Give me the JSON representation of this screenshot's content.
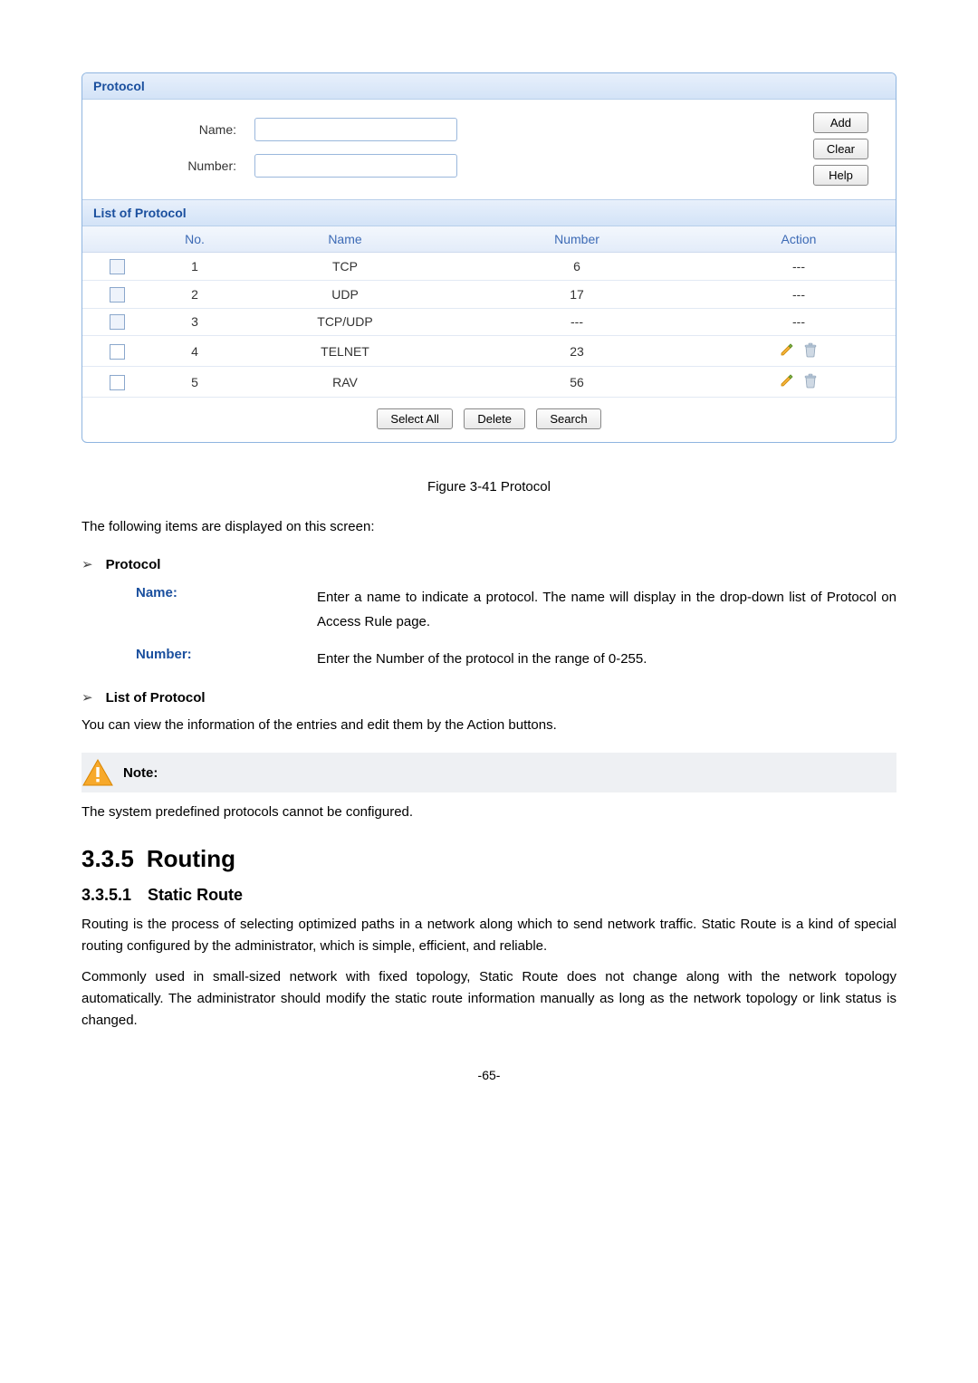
{
  "panel": {
    "title": "Protocol",
    "form": {
      "name_label": "Name:",
      "name_value": "",
      "number_label": "Number:",
      "number_value": ""
    },
    "buttons": {
      "add": "Add",
      "clear": "Clear",
      "help": "Help"
    },
    "list_title": "List of Protocol",
    "columns": {
      "chk": "",
      "no": "No.",
      "name": "Name",
      "number": "Number",
      "action": "Action"
    },
    "rows": [
      {
        "chk_disabled": true,
        "no": "1",
        "name": "TCP",
        "number": "6",
        "action": "text",
        "action_text": "---"
      },
      {
        "chk_disabled": true,
        "no": "2",
        "name": "UDP",
        "number": "17",
        "action": "text",
        "action_text": "---"
      },
      {
        "chk_disabled": true,
        "no": "3",
        "name": "TCP/UDP",
        "number": "---",
        "action": "text",
        "action_text": "---"
      },
      {
        "chk_disabled": false,
        "no": "4",
        "name": "TELNET",
        "number": "23",
        "action": "icons"
      },
      {
        "chk_disabled": false,
        "no": "5",
        "name": "RAV",
        "number": "56",
        "action": "icons"
      }
    ],
    "bottom_buttons": {
      "select_all": "Select All",
      "delete": "Delete",
      "search": "Search"
    }
  },
  "caption": "Figure 3-41 Protocol",
  "intro": "The following items are displayed on this screen:",
  "sections": {
    "protocol_bullet": "Protocol",
    "name_term": "Name:",
    "name_desc": "Enter a name to indicate a protocol. The name will display in the drop-down list of Protocol on Access Rule page.",
    "number_term": "Number:",
    "number_desc": "Enter the Number of the protocol in the range of 0-255.",
    "list_bullet": "List of Protocol",
    "list_desc": "You can view the information of the entries and edit them by the Action buttons."
  },
  "note": {
    "label": "Note:",
    "text": "The system predefined protocols cannot be configured."
  },
  "routing": {
    "section_num": "3.3.5",
    "section_title": "Routing",
    "sub_num": "3.3.5.1",
    "sub_title": "Static Route",
    "p1": "Routing is the process of selecting optimized paths in a network along which to send network traffic. Static Route is a kind of special routing configured by the administrator, which is simple, efficient, and reliable.",
    "p2": "Commonly used in small-sized network with fixed topology, Static Route does not change along with the network topology automatically. The administrator should modify the static route information manually as long as the network topology or link status is changed."
  },
  "page_number": "-65-"
}
